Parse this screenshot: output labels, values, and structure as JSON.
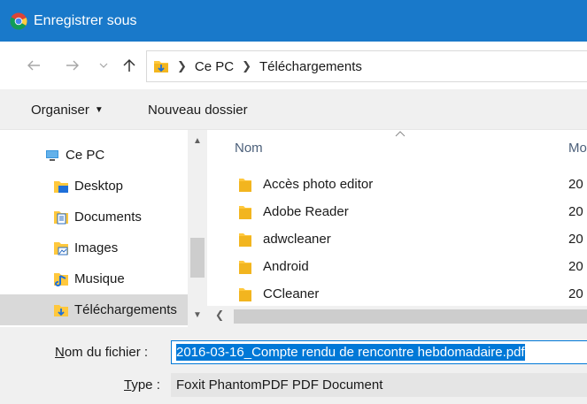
{
  "window": {
    "title": "Enregistrer sous",
    "icon": "chrome-icon"
  },
  "address": {
    "crumbs": [
      "Ce PC",
      "Téléchargements"
    ],
    "back_icon": "arrow-left-icon",
    "forward_icon": "arrow-right-icon",
    "recent_icon": "chevron-down-icon",
    "up_icon": "arrow-up-icon"
  },
  "toolbar": {
    "organize_label": "Organiser",
    "new_folder_label": "Nouveau dossier"
  },
  "navpane": {
    "items": [
      {
        "label": "Ce PC",
        "icon": "computer-icon"
      },
      {
        "label": "Desktop",
        "icon": "desktop-folder-icon"
      },
      {
        "label": "Documents",
        "icon": "documents-folder-icon"
      },
      {
        "label": "Images",
        "icon": "images-folder-icon"
      },
      {
        "label": "Musique",
        "icon": "music-folder-icon"
      },
      {
        "label": "Téléchargements",
        "icon": "downloads-folder-icon",
        "selected": true
      }
    ]
  },
  "files": {
    "columns": {
      "name": "Nom",
      "modified": "Mo"
    },
    "rows": [
      {
        "name": "Accès photo editor",
        "date": "20"
      },
      {
        "name": "Adobe Reader",
        "date": "20"
      },
      {
        "name": "adwcleaner",
        "date": "20"
      },
      {
        "name": "Android",
        "date": "20"
      },
      {
        "name": "CCleaner",
        "date": "20"
      }
    ]
  },
  "form": {
    "filename_label_underlined": "N",
    "filename_label_rest": "om du fichier :",
    "filename_value": "2016-03-16_Compte rendu de rencontre hebdomadaire.pdf",
    "type_label_underlined": "T",
    "type_label_rest": "ype :",
    "type_value": "Foxit PhantomPDF PDF Document"
  },
  "colors": {
    "titlebar": "#1979ca",
    "selection": "#0078d7",
    "folder": "#ffc83d"
  }
}
